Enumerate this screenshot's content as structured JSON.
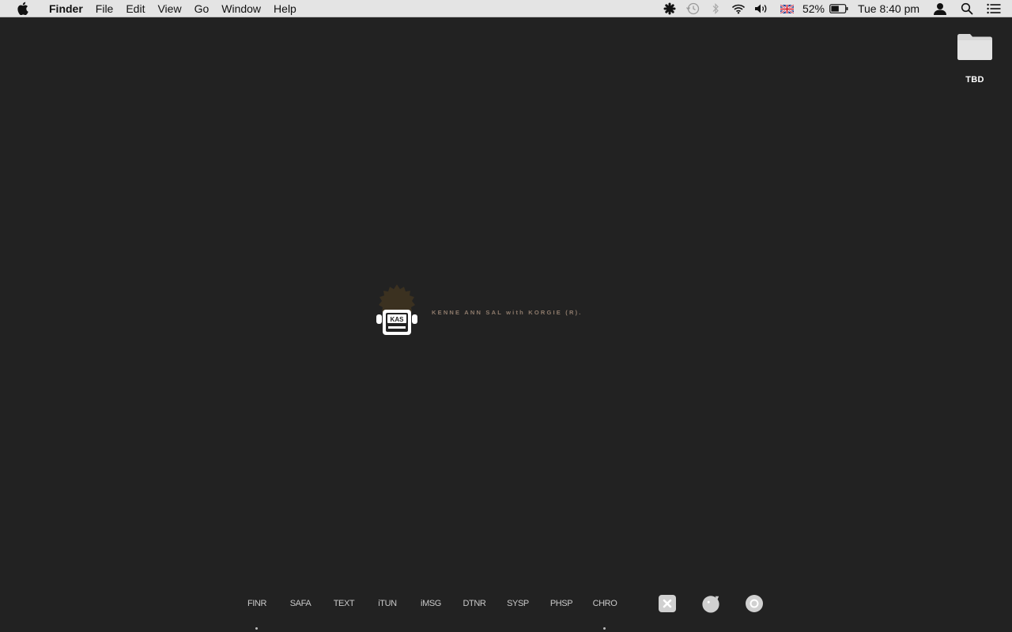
{
  "menubar": {
    "app_name": "Finder",
    "items": [
      "File",
      "Edit",
      "View",
      "Go",
      "Window",
      "Help"
    ],
    "battery_percent": "52%",
    "clock": "Tue 8:40 pm",
    "icons": [
      "apple-icon",
      "asterisk-icon",
      "time-machine-icon",
      "bluetooth-icon",
      "wifi-icon",
      "volume-icon",
      "uk-flag-icon",
      "battery-icon",
      "user-icon",
      "spotlight-icon",
      "notification-center-icon"
    ]
  },
  "desktop": {
    "folder_label": "TBD",
    "logo": {
      "badge_text": "KAS",
      "tagline": "KENNE ANN SAL with KORGIE (R)."
    }
  },
  "dock": {
    "apps": [
      "FINR",
      "SAFA",
      "TEXT",
      "iTUN",
      "iMSG",
      "DTNR",
      "SYSP",
      "PHSP",
      "CHRO"
    ],
    "running": [
      "FINR",
      "CHRO"
    ],
    "buttons": [
      "close-button-icon",
      "bubble-icon",
      "ring-icon"
    ]
  },
  "colors": {
    "desktop_bg": "#222222",
    "menubar_bg": "#e4e4e4",
    "dock_text": "#c9c9c9",
    "logo_text": "#8e7b6c",
    "logo_spikes": "#3b3120"
  }
}
